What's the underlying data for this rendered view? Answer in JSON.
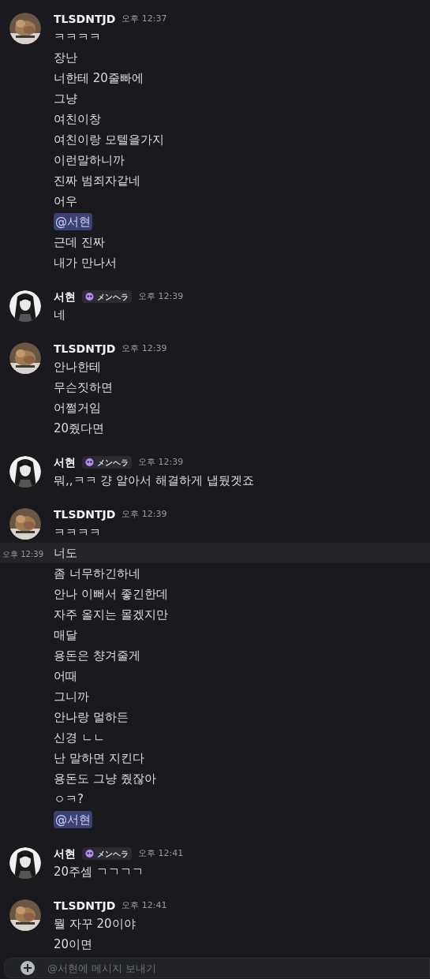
{
  "messages": [
    {
      "author": "TLSDNTJD",
      "time": "오후 12:37",
      "lines": [
        {
          "text": "ㅋㅋㅋㅋ",
          "kind": "text"
        },
        {
          "text": "장난",
          "kind": "text"
        },
        {
          "text": "너한테 20줄빠에",
          "kind": "text"
        },
        {
          "text": "그냥",
          "kind": "text"
        },
        {
          "text": "여친이창",
          "kind": "text"
        },
        {
          "text": "여친이랑 모텔을가지",
          "kind": "text"
        },
        {
          "text": "이런말하니까",
          "kind": "text"
        },
        {
          "text": "진짜 범죄자같네",
          "kind": "text"
        },
        {
          "text": "어우",
          "kind": "text"
        },
        {
          "text": "@서현",
          "kind": "mention"
        },
        {
          "text": "근데 진짜",
          "kind": "text"
        },
        {
          "text": "내가 만나서",
          "kind": "text"
        }
      ]
    },
    {
      "author": "서현",
      "badge": "メンヘラ",
      "time": "오후 12:39",
      "lines": [
        {
          "text": "네",
          "kind": "text"
        }
      ]
    },
    {
      "author": "TLSDNTJD",
      "time": "오후 12:39",
      "lines": [
        {
          "text": "안나한테",
          "kind": "text"
        },
        {
          "text": "무슨짓하면",
          "kind": "text"
        },
        {
          "text": "어쩔거임",
          "kind": "text"
        },
        {
          "text": "20줬다면",
          "kind": "text"
        }
      ]
    },
    {
      "author": "서현",
      "badge": "メンヘラ",
      "time": "오후 12:39",
      "lines": [
        {
          "text": "뭐,,ㅋㅋ 걍 알아서 해결하게 냅뒀겟죠",
          "kind": "text"
        }
      ]
    },
    {
      "author": "TLSDNTJD",
      "time": "오후 12:39",
      "lines": [
        {
          "text": "ㅋㅋㅋㅋ",
          "kind": "text"
        },
        {
          "text": "너도",
          "kind": "text",
          "hovered": true,
          "hover_time": "오후 12:39"
        },
        {
          "text": "좀 너무하긴하네",
          "kind": "text"
        },
        {
          "text": "안나 이뻐서 좋긴한데",
          "kind": "text"
        },
        {
          "text": "자주 올지는 몰겠지만",
          "kind": "text"
        },
        {
          "text": "매달",
          "kind": "text"
        },
        {
          "text": "용돈은 챵겨줄게",
          "kind": "text"
        },
        {
          "text": "어때",
          "kind": "text"
        },
        {
          "text": "그니까",
          "kind": "text"
        },
        {
          "text": "안나랑 멀하든",
          "kind": "text"
        },
        {
          "text": "신경 ㄴㄴ",
          "kind": "text"
        },
        {
          "text": "난 말하면 지킨다",
          "kind": "text"
        },
        {
          "text": "용돈도 그냥 줬잖아",
          "kind": "text"
        },
        {
          "text": "ㅇㅋ?",
          "kind": "text"
        },
        {
          "text": "@서현",
          "kind": "mention"
        }
      ]
    },
    {
      "author": "서현",
      "badge": "メンヘラ",
      "time": "오후 12:41",
      "lines": [
        {
          "text": "20주셈 ㄱㄱㄱㄱ",
          "kind": "text"
        }
      ]
    },
    {
      "author": "TLSDNTJD",
      "time": "오후 12:41",
      "lines": [
        {
          "text": "뭘 자꾸 20이야",
          "kind": "text"
        },
        {
          "text": "20이면",
          "kind": "text"
        }
      ]
    }
  ],
  "composer": {
    "placeholder": "@서현에 메시지 보내기"
  }
}
